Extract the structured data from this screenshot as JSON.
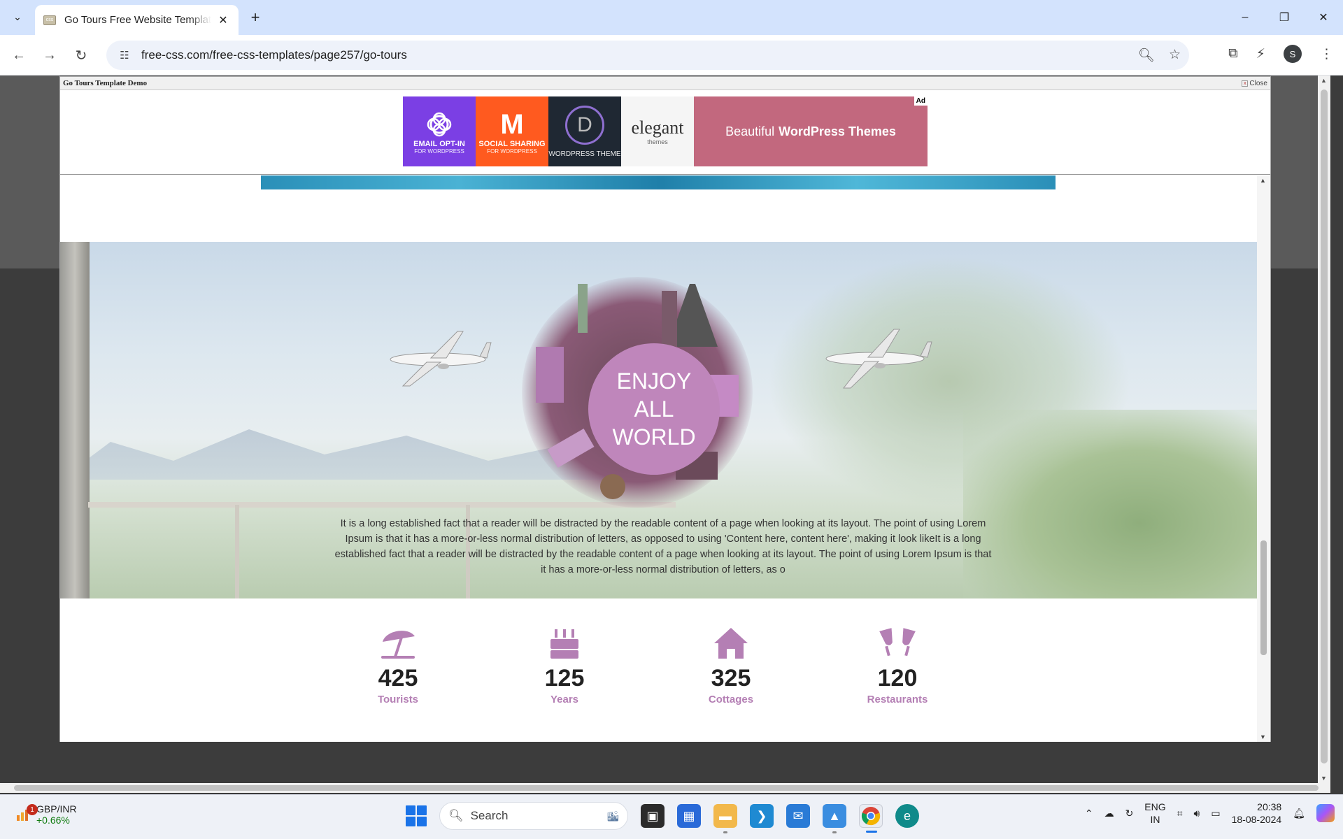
{
  "browser": {
    "tab_title": "Go Tours Free Website Template",
    "url": "free-css.com/free-css-templates/page257/go-tours",
    "tab_favicon_text": "css"
  },
  "frame": {
    "title": "Go Tours Template Demo",
    "close_label": "Close"
  },
  "ad": {
    "tile1_line1": "EMAIL OPT-IN",
    "tile1_line2": "FOR WORDPRESS",
    "tile2_letter": "M",
    "tile2_line1": "SOCIAL SHARING",
    "tile2_line2": "FOR WORDPRESS",
    "tile3_letter": "D",
    "tile3_line1": "WORDPRESS THEME",
    "tile4_word": "elegant",
    "tile4_sub": "themes",
    "banner_plain": "Beautiful",
    "banner_bold": "WordPress Themes",
    "badge": "Ad"
  },
  "hero": {
    "circle_line1": "ENJOY",
    "circle_line2": "ALL",
    "circle_line3": "WORLD",
    "paragraph": "It is a long established fact that a reader will be distracted by the readable content of a page when looking at its layout. The point of using Lorem Ipsum is that it has a more-or-less normal distribution of letters, as opposed to using 'Content here, content here', making it look likeIt is a long established fact that a reader will be distracted by the readable content of a page when looking at its layout. The point of using Lorem Ipsum is that it has a more-or-less normal distribution of letters, as o"
  },
  "stats": [
    {
      "icon": "beach-umbrella-icon",
      "number": "425",
      "label": "Tourists"
    },
    {
      "icon": "birthday-cake-icon",
      "number": "125",
      "label": "Years"
    },
    {
      "icon": "house-icon",
      "number": "325",
      "label": "Cottages"
    },
    {
      "icon": "cheers-glasses-icon",
      "number": "120",
      "label": "Restaurants"
    }
  ],
  "colors": {
    "accent": "#bf86bb",
    "stat_label": "#b47fb4",
    "tabbar": "#d3e3fd"
  },
  "taskbar": {
    "stock_name": "GBP/INR",
    "stock_change": "+0.66%",
    "stock_badge": "1",
    "search_placeholder": "Search",
    "lang_line1": "ENG",
    "lang_line2": "IN",
    "time": "20:38",
    "date": "18-08-2024"
  },
  "avatar_initial": "S"
}
